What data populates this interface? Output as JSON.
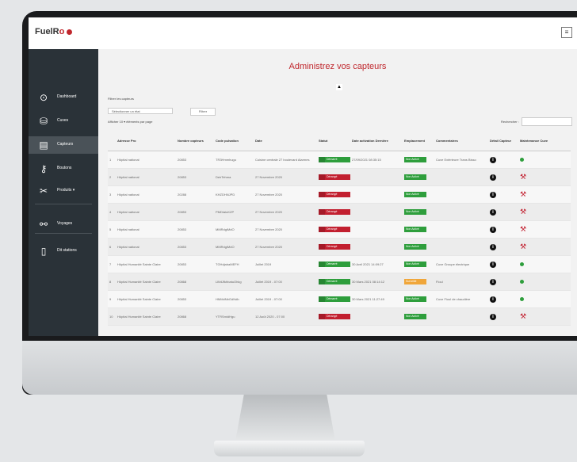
{
  "app": {
    "logo_text": "FuelR",
    "logo_accent": "o",
    "menu_symbol": "≡"
  },
  "sidebar": {
    "items": [
      {
        "label": "Dashboard",
        "icon": "dashboard-icon",
        "glyph": "⊙",
        "active": false
      },
      {
        "label": "Cuves",
        "icon": "tank-icon",
        "glyph": "⛁",
        "active": false
      },
      {
        "label": "Capteurs",
        "icon": "sensor-icon",
        "glyph": "▤",
        "active": true
      },
      {
        "label": "Boutons",
        "icon": "key-icon",
        "glyph": "⚷",
        "active": false
      },
      {
        "label": "Produits ▾",
        "icon": "tools-icon",
        "glyph": "✂",
        "active": false
      },
      {
        "label": "Voyages",
        "icon": "link-icon",
        "glyph": "⚯",
        "active": false
      },
      {
        "label": "Dit stations",
        "icon": "phone-icon",
        "glyph": "▯",
        "active": false
      }
    ]
  },
  "main": {
    "title": "Administrez vos capteurs",
    "collapse_symbol": "▲",
    "filters_label": "Filtrer les capteurs",
    "filter_select": "Sélectionner un état",
    "filter_button": "Filtrer",
    "length_label": "Afficher 10 ▾ éléments par page",
    "search_label": "Rechercher :"
  },
  "table": {
    "headers": [
      "",
      "Adresse Pro",
      "Nombre capteurs",
      "Code pulsation",
      "Date",
      "Statut",
      "Date activation Dernière",
      "Emplacement",
      "Commentaires",
      "Détail Capteur",
      "Maintenance Cuve"
    ],
    "rows": [
      {
        "num": "1",
        "name": "Hôpital national",
        "count": "20853",
        "code": "TR3Hmmhugu",
        "date": "Cuisine centrale 27 boulevard Alarmes",
        "status": "Démarré",
        "status_color": "#2e9e3c",
        "last": "27/09/2021 08:35:15",
        "loc": "Non Activé",
        "loc_color": "#2e9e3c",
        "comment": "Cuve Extérieure Trans Bisso",
        "maint": "ok"
      },
      {
        "num": "2",
        "name": "Hôpital national",
        "count": "20853",
        "code": "DeirTehma",
        "date": "27 Novembre 2020",
        "status": "Dérangé",
        "status_color": "#c21f2f",
        "last": "",
        "loc": "Non Activé",
        "loc_color": "#2e9e3c",
        "comment": "",
        "maint": "wrench"
      },
      {
        "num": "3",
        "name": "Hôpital national",
        "count": "20288",
        "code": "KHZDHNJPD",
        "date": "27 Novembre 2020",
        "status": "Dérangé",
        "status_color": "#c21f2f",
        "last": "",
        "loc": "Non Activé",
        "loc_color": "#2e9e3c",
        "comment": "",
        "maint": "wrench"
      },
      {
        "num": "4",
        "name": "Hôpital national",
        "count": "20853",
        "code": "PMDIaluKZP",
        "date": "27 Novembre 2020",
        "status": "Dérangé",
        "status_color": "#c21f2f",
        "last": "",
        "loc": "Non Activé",
        "loc_color": "#2e9e3c",
        "comment": "",
        "maint": "wrench"
      },
      {
        "num": "5",
        "name": "Hôpital national",
        "count": "20853",
        "code": "MMRdgiMdO",
        "date": "27 Novembre 2020",
        "status": "Dérangé",
        "status_color": "#c21f2f",
        "last": "",
        "loc": "Non Activé",
        "loc_color": "#2e9e3c",
        "comment": "",
        "maint": "wrench"
      },
      {
        "num": "6",
        "name": "Hôpital national",
        "count": "20853",
        "code": "MMRdgiMdO",
        "date": "27 Novembre 2020",
        "status": "Dérangé",
        "status_color": "#c21f2f",
        "last": "",
        "loc": "Non Activé",
        "loc_color": "#2e9e3c",
        "comment": "",
        "maint": "wrench"
      },
      {
        "num": "7",
        "name": "Hôpital Humanité Sainte Claire",
        "count": "20853",
        "code": "TGHdjabaMEFH",
        "date": "Juillet 2019",
        "status": "Démarré",
        "status_color": "#2e9e3c",
        "last": "30 Avril 2021 14:09:27",
        "loc": "Non Activé",
        "loc_color": "#2e9e3c",
        "comment": "Cuve Groupe électrique",
        "maint": "ok"
      },
      {
        "num": "8",
        "name": "Hôpital Humanité Sainte Claire",
        "count": "20868",
        "code": "LWdJfkhbatuOhkg",
        "date": "Juillet 2019 - 07:00",
        "status": "Démarré",
        "status_color": "#2e9e3c",
        "last": "30 Mars 2021 08:14:12",
        "loc": "Surveillé",
        "loc_color": "#f0a63a",
        "comment": "Fioul",
        "maint": "ok"
      },
      {
        "num": "9",
        "name": "Hôpital Humanité Sainte Claire",
        "count": "20853",
        "code": "HMMdNbGdNdb",
        "date": "Juillet 2019 - 07:00",
        "status": "Démarré",
        "status_color": "#2e9e3c",
        "last": "30 Mars 2021 11:27:49",
        "loc": "Non Activé",
        "loc_color": "#2e9e3c",
        "comment": "Cuve Fioul de chaudière",
        "maint": "ok"
      },
      {
        "num": "10",
        "name": "Hôpital Humanité Sainte Claire",
        "count": "20868",
        "code": "YTRSmldHgu",
        "date": "12 Août 2020 - 07:00",
        "status": "Dérangé",
        "status_color": "#c21f2f",
        "last": "",
        "loc": "Non Activé",
        "loc_color": "#2e9e3c",
        "comment": "",
        "maint": "wrench"
      }
    ]
  }
}
